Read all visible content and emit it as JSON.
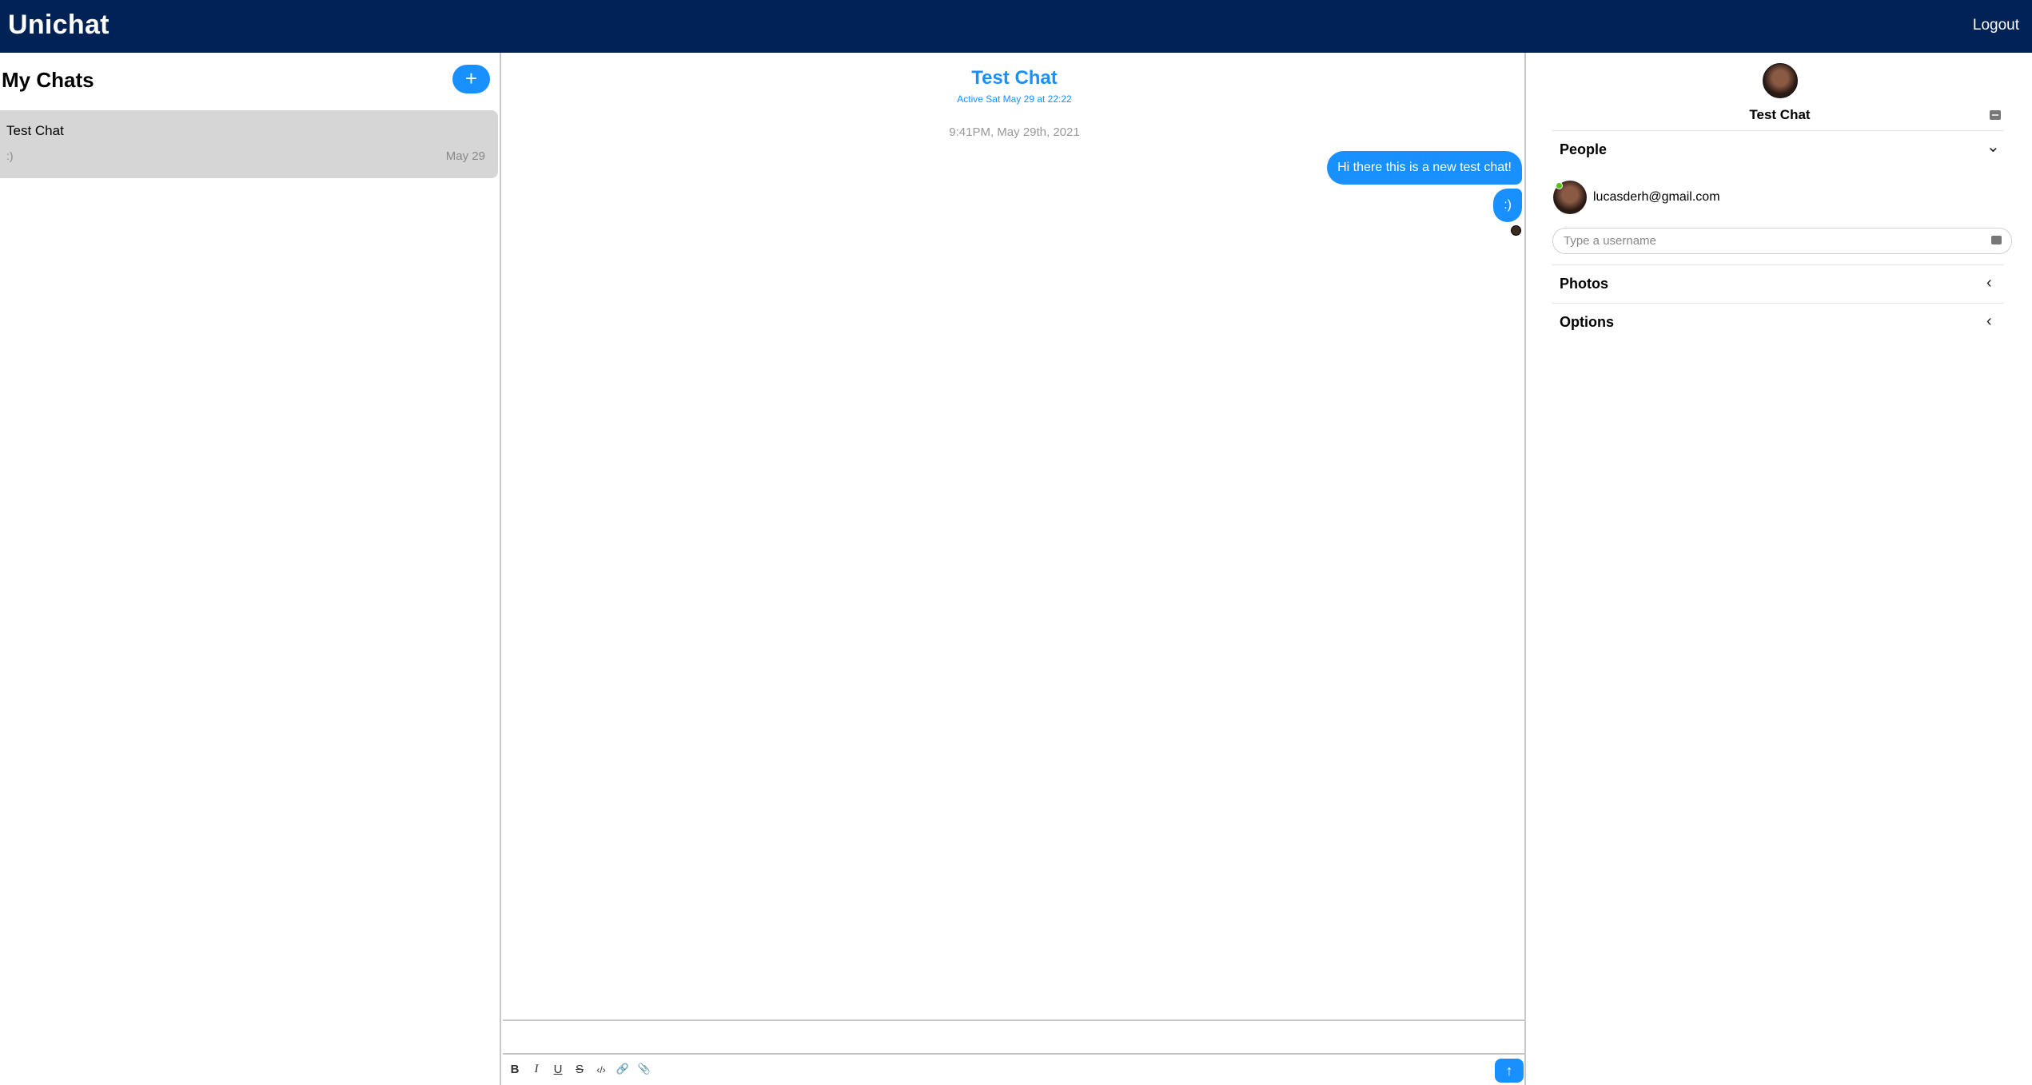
{
  "app": {
    "brand": "Unichat",
    "logout_label": "Logout"
  },
  "chat_list": {
    "title": "My Chats",
    "new_chat_label": "+",
    "chats": [
      {
        "name": "Test Chat",
        "last_message": ":)",
        "date": "May 29"
      }
    ]
  },
  "feed": {
    "title": "Test Chat",
    "subtitle": "Active Sat May 29 at 22:22",
    "timestamp": "9:41PM, May 29th, 2021",
    "messages": [
      {
        "text": "Hi there this is a new test chat!",
        "own": true
      },
      {
        "text": ":)",
        "own": true
      }
    ],
    "compose_value": "",
    "toolbar": {
      "bold": "B",
      "italic": "I",
      "underline": "U",
      "strike": "S",
      "code": "‹/›",
      "link": "🔗",
      "attach": "📎",
      "send": "↑"
    }
  },
  "settings": {
    "chat_name": "Test Chat",
    "people_label": "People",
    "people": [
      {
        "email": "lucasderh@gmail.com",
        "online": true
      }
    ],
    "username_placeholder": "Type a username",
    "photos_label": "Photos",
    "options_label": "Options",
    "chevron_open": "⌄",
    "chevron_closed": "‹"
  },
  "colors": {
    "header_bg": "#002255",
    "accent": "#1890ff",
    "selected_chat_bg": "#d6d6d6",
    "online": "#52c41a"
  },
  "icons": [
    "plus-icon",
    "read-receipt-avatar-icon",
    "settings-icon",
    "chevron-down-icon",
    "chevron-left-icon",
    "send-arrow-icon"
  ]
}
